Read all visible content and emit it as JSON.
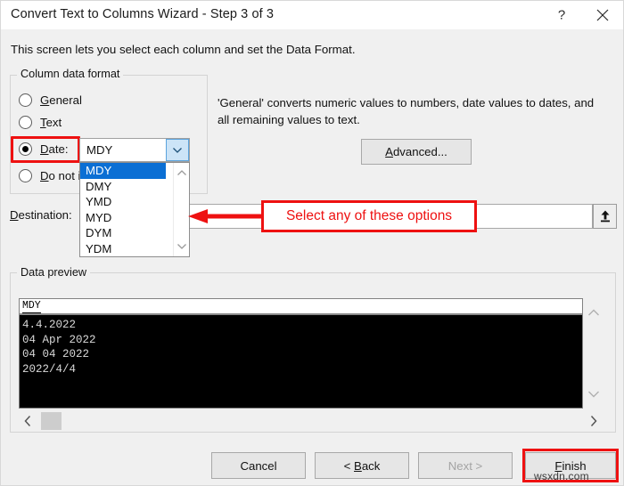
{
  "window": {
    "title": "Convert Text to Columns Wizard - Step 3 of 3",
    "help_icon": "?",
    "close_icon": "×"
  },
  "intro": {
    "text": "This screen lets you select each column and set the Data Format."
  },
  "column_data_format": {
    "caption": "Column data format",
    "options": [
      {
        "label": "General",
        "accel": "G",
        "checked": false
      },
      {
        "label": "Text",
        "accel": "T",
        "checked": false
      },
      {
        "label": "Date:",
        "accel": "D",
        "checked": true
      },
      {
        "label": "Do not import column (skip)",
        "accel": "D",
        "checked": false
      }
    ]
  },
  "date_format": {
    "selected": "MDY",
    "options": [
      "MDY",
      "DMY",
      "YMD",
      "MYD",
      "DYM",
      "YDM"
    ],
    "dropdown_open": true
  },
  "info": {
    "text": "'General' converts numeric values to numbers, date values to dates, and all remaining values to text.",
    "advanced_label": "Advanced..."
  },
  "destination": {
    "label": "Destination:",
    "value": "",
    "picker_icon": "range-select-icon"
  },
  "annotation": {
    "callout_text": "Select any of these options",
    "color": "#ee1111"
  },
  "data_preview": {
    "caption": "Data preview",
    "column_header": "MDY",
    "rows": [
      "4.4.2022",
      "04 Apr 2022",
      "04 04 2022",
      "2022/4/4"
    ]
  },
  "footer": {
    "cancel": "Cancel",
    "back": "< Back",
    "back_accel": "B",
    "next": "Next >",
    "next_enabled": false,
    "finish": "Finish",
    "finish_accel": "F",
    "finish_highlighted": true
  },
  "watermark": {
    "text": "wsxdn.com"
  }
}
